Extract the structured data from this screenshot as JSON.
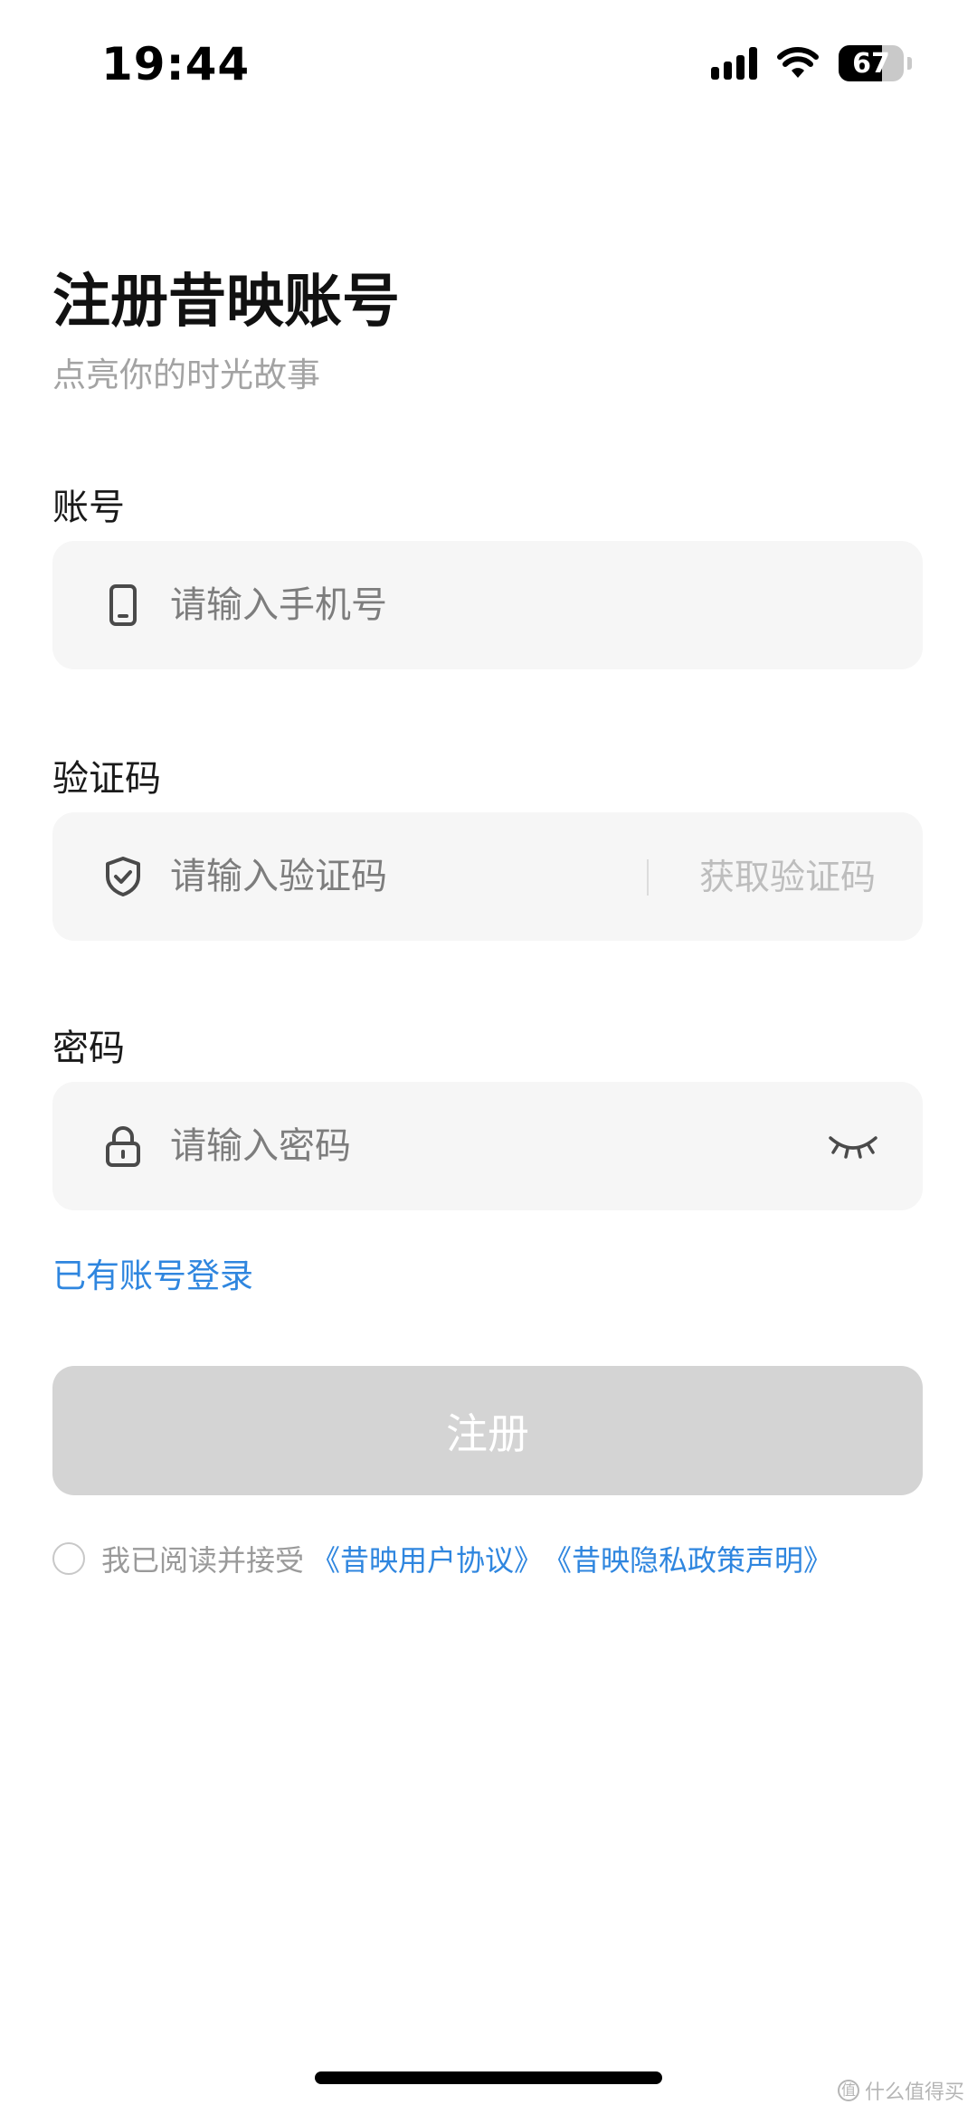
{
  "status_bar": {
    "time": "19:44",
    "battery": "67",
    "battery_level": 0.67,
    "signal_icon": "cellular-signal-icon",
    "wifi_icon": "wifi-icon"
  },
  "header": {
    "title": "注册昔映账号",
    "subtitle": "点亮你的时光故事"
  },
  "form": {
    "account_label": "账号",
    "account_placeholder": "请输入手机号",
    "account_icon": "phone-icon",
    "code_label": "验证码",
    "code_placeholder": "请输入验证码",
    "code_icon": "shield-check-icon",
    "get_code": "获取验证码",
    "password_label": "密码",
    "password_placeholder": "请输入密码",
    "password_icon": "lock-icon",
    "password_toggle_icon": "eye-closed-icon"
  },
  "login_link": "已有账号登录",
  "register_button": "注册",
  "agreement": {
    "text": "我已阅读并接受",
    "user_agreement": "《昔映用户协议》",
    "privacy_policy": "《昔映隐私政策声明》",
    "checked": false
  },
  "colors": {
    "link": "#2f86df",
    "input_bg": "#f6f6f6",
    "button_disabled": "#d4d4d4"
  },
  "watermark": "什么值得买"
}
